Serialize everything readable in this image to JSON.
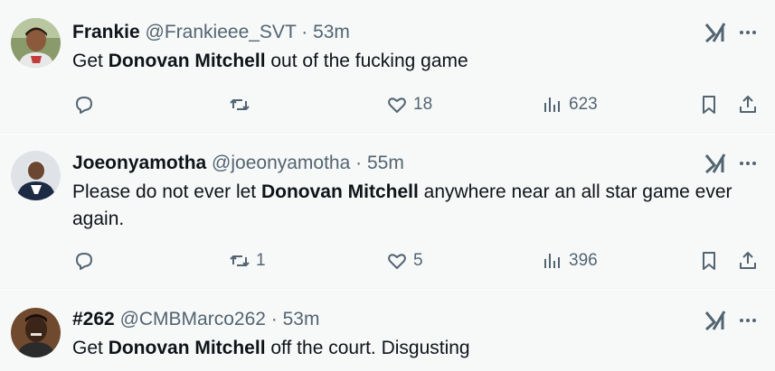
{
  "tweets": [
    {
      "name": "Frankie",
      "handle": "@Frankieee_SVT",
      "dot": "·",
      "time": "53m",
      "text_before": "Get ",
      "text_bold": "Donovan Mitchell",
      "text_after": " out of the fucking game",
      "replies": "",
      "retweets": "",
      "likes": "18",
      "views": "623"
    },
    {
      "name": "Joeonyamotha",
      "handle": "@joeonyamotha",
      "dot": "·",
      "time": "55m",
      "text_before": "Please do not ever let ",
      "text_bold": "Donovan Mitchell",
      "text_after": " anywhere near an all star game ever again.",
      "replies": "",
      "retweets": "1",
      "likes": "5",
      "views": "396"
    },
    {
      "name": "#262",
      "handle": "@CMBMarco262",
      "dot": "·",
      "time": "53m",
      "text_before": "Get ",
      "text_bold": "Donovan Mitchell",
      "text_after": " off the court. Disgusting"
    }
  ],
  "icons": {
    "reply": "reply-icon",
    "retweet": "retweet-icon",
    "like": "heart-icon",
    "views": "views-icon",
    "bookmark": "bookmark-icon",
    "share": "share-icon",
    "grok": "grok-icon",
    "more": "more-icon"
  },
  "colors": {
    "text": "#0f1419",
    "secondary": "#536471",
    "background": "#f7f9f9",
    "divider": "#eff3f4"
  }
}
